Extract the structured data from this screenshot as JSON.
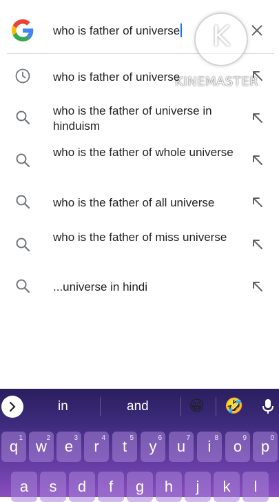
{
  "search": {
    "query": "who is father of universe",
    "clear_icon": "close-icon",
    "logo": "google-g-logo"
  },
  "watermark": {
    "logo_letter": "K",
    "text": "KINEMASTER"
  },
  "suggestions": [
    {
      "icon": "history-icon",
      "text": "who is father of universe"
    },
    {
      "icon": "search-icon",
      "text": "who is the father of universe in hinduism"
    },
    {
      "icon": "search-icon",
      "text": "who is the father of whole universe"
    },
    {
      "icon": "search-icon",
      "text": "who is the father of all universe"
    },
    {
      "icon": "search-icon",
      "text": "who is the father of miss universe"
    },
    {
      "icon": "search-icon",
      "text": "...universe in hindi"
    }
  ],
  "keyboard": {
    "suggestions": [
      "in",
      "and"
    ],
    "emojis": [
      "😁",
      "🤣"
    ],
    "row1": [
      {
        "key": "q",
        "hint": "1"
      },
      {
        "key": "w",
        "hint": "2"
      },
      {
        "key": "e",
        "hint": "3"
      },
      {
        "key": "r",
        "hint": "4"
      },
      {
        "key": "t",
        "hint": "5"
      },
      {
        "key": "y",
        "hint": "6"
      },
      {
        "key": "u",
        "hint": "7"
      },
      {
        "key": "i",
        "hint": "8"
      },
      {
        "key": "o",
        "hint": "9"
      },
      {
        "key": "p",
        "hint": "0"
      }
    ],
    "row2": [
      "a",
      "s",
      "d",
      "f",
      "g",
      "h",
      "j",
      "k",
      "l"
    ]
  },
  "colors": {
    "google_blue": "#4285F4",
    "google_red": "#EA4335",
    "google_yellow": "#FBBC05",
    "google_green": "#34A853",
    "keyboard_top": "#2a1f5e",
    "keyboard_bottom": "#8b4dbf"
  }
}
